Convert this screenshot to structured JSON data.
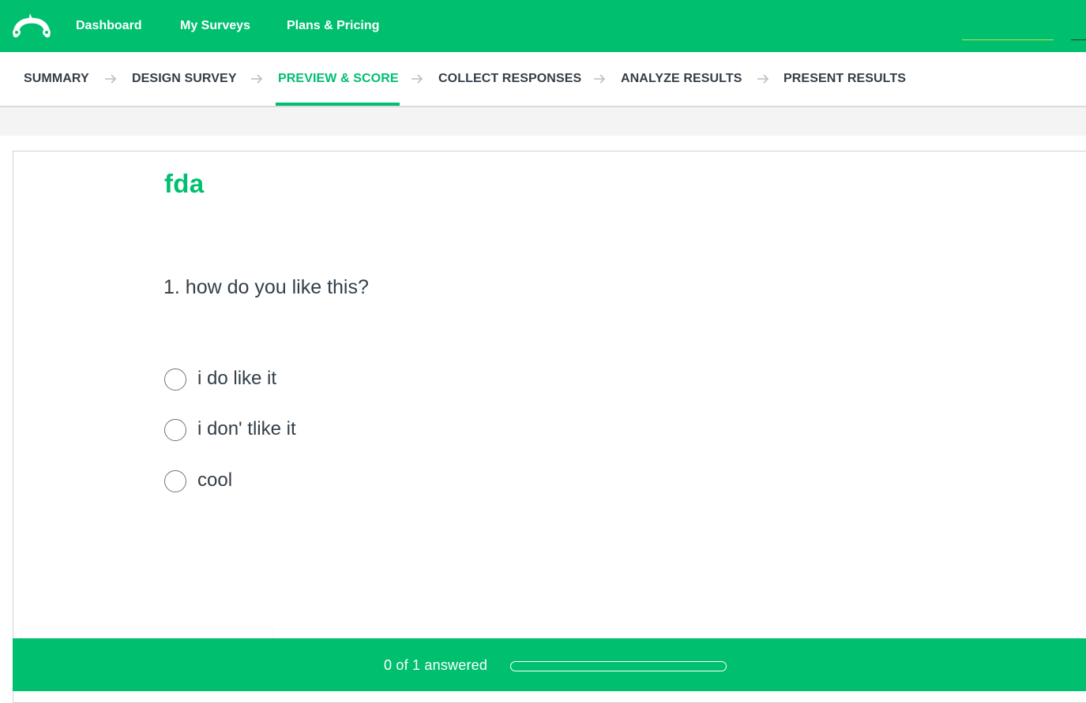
{
  "topnav": {
    "items": [
      "Dashboard",
      "My Surveys",
      "Plans & Pricing"
    ]
  },
  "steps": [
    {
      "label": "SUMMARY",
      "active": false
    },
    {
      "label": "DESIGN SURVEY",
      "active": false
    },
    {
      "label": "PREVIEW & SCORE",
      "active": true
    },
    {
      "label": "COLLECT RESPONSES",
      "active": false
    },
    {
      "label": "ANALYZE RESULTS",
      "active": false
    },
    {
      "label": "PRESENT RESULTS",
      "active": false
    }
  ],
  "survey": {
    "title": "fda",
    "question": "1. how do you like this?",
    "options": [
      "i do like it",
      "i don' tlike it",
      "cool"
    ],
    "selected_option": null
  },
  "progress": {
    "text": "0 of 1 answered",
    "answered": 0,
    "total": 1
  },
  "colors": {
    "brand_green": "#00bf6f",
    "text_dark": "#333e48",
    "active_step": "#00bf6f"
  },
  "icons": {
    "logo": "surveymonkey-logo",
    "step_separator": "arrow-right-icon"
  }
}
